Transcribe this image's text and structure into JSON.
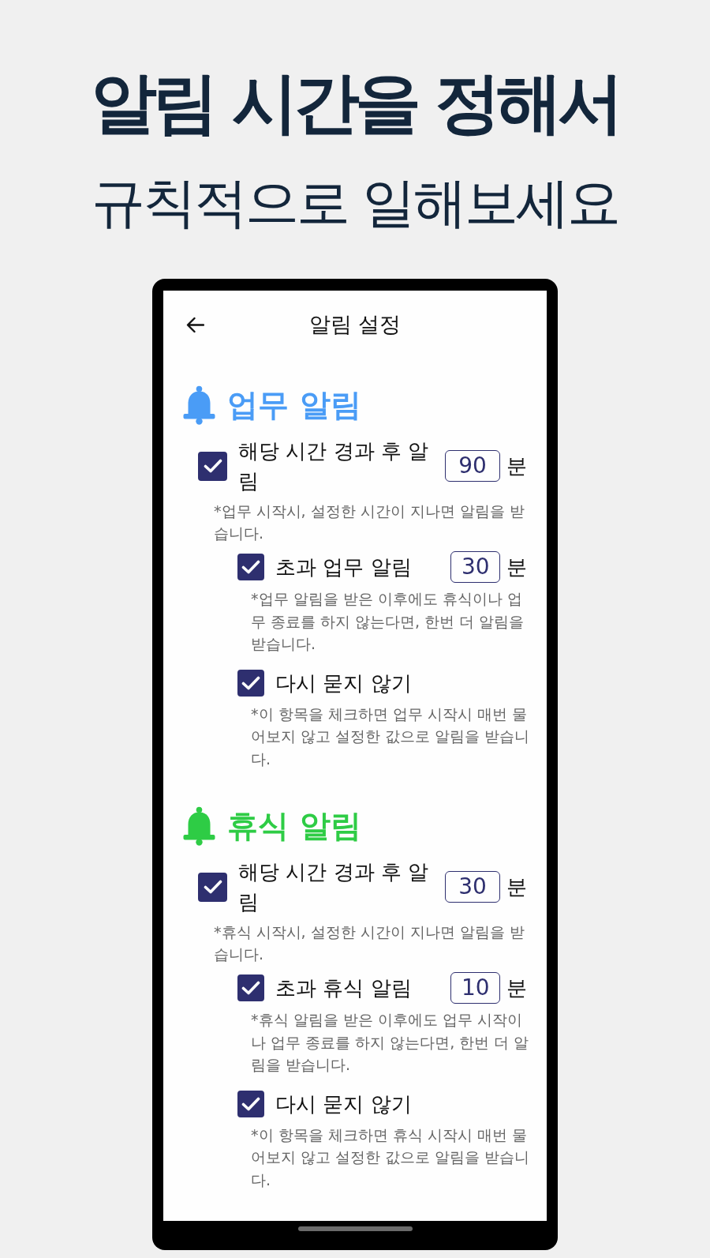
{
  "headline": {
    "title": "알림 시간을 정해서",
    "subtitle": "규칙적으로 일해보세요"
  },
  "app_bar": {
    "title": "알림 설정"
  },
  "sections": [
    {
      "title": "업무 알림",
      "color": "#4a9cf6",
      "options": [
        {
          "kind": "minutes",
          "label": "해당 시간 경과 후 알림",
          "checked": true,
          "value": "90",
          "unit": "분",
          "description": "*업무 시작시, 설정한 시간이 지나면 알림을 받습니다.",
          "children": [
            {
              "kind": "minutes",
              "label": "초과 업무 알림",
              "checked": true,
              "value": "30",
              "unit": "분",
              "description": "*업무 알림을 받은 이후에도 휴식이나 업무 종료를 하지 않는다면, 한번 더 알림을 받습니다."
            },
            {
              "kind": "toggle",
              "label": "다시 묻지 않기",
              "checked": true,
              "description": "*이 항목을 체크하면 업무 시작시 매번 물어보지 않고 설정한 값으로 알림을 받습니다."
            }
          ]
        }
      ]
    },
    {
      "title": "휴식 알림",
      "color": "#2ecc45",
      "options": [
        {
          "kind": "minutes",
          "label": "해당 시간 경과 후 알림",
          "checked": true,
          "value": "30",
          "unit": "분",
          "description": "*휴식 시작시, 설정한 시간이 지나면 알림을 받습니다.",
          "children": [
            {
              "kind": "minutes",
              "label": "초과 휴식 알림",
              "checked": true,
              "value": "10",
              "unit": "분",
              "description": "*휴식 알림을 받은 이후에도 업무 시작이나 업무 종료를 하지 않는다면, 한번 더 알림을 받습니다."
            },
            {
              "kind": "toggle",
              "label": "다시 묻지 않기",
              "checked": true,
              "description": "*이 항목을 체크하면 휴식 시작시 매번 물어보지 않고 설정한 값으로 알림을 받습니다."
            }
          ]
        }
      ]
    }
  ]
}
